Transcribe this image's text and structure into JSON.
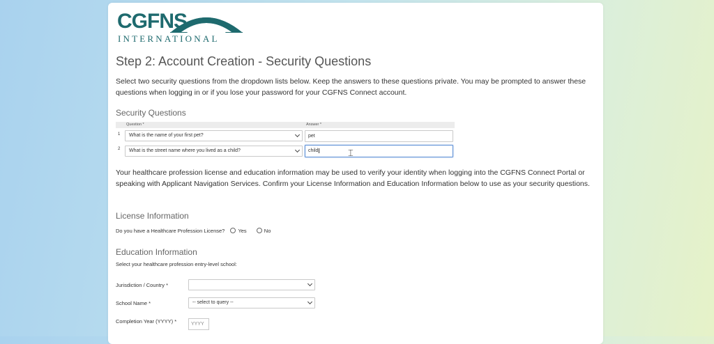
{
  "logo": {
    "main": "CGFNS",
    "sub": "INTERNATIONAL"
  },
  "page_title": "Step 2: Account Creation - Security Questions",
  "intro": "Select two security questions from the dropdown lists below. Keep the answers to these questions private. You may be prompted to answer these questions when logging in or if you lose your password for your CGFNS Connect account.",
  "security_questions": {
    "heading": "Security Questions",
    "col_question": "Question *",
    "col_answer": "Answer *",
    "rows": [
      {
        "num": "1",
        "question": "What is the name of your first pet?",
        "answer": "pet"
      },
      {
        "num": "2",
        "question": "What is the street name where you lived as a child?",
        "answer": "child"
      }
    ]
  },
  "verify_text": "Your healthcare profession license and education information may be used to verify your identity when logging into the CGFNS Connect Portal or speaking with Applicant Navigation Services. Confirm your License Information and Education Information below to use as your security questions.",
  "license": {
    "heading": "License Information",
    "question": "Do you have a Healthcare Profession License?",
    "yes": "Yes",
    "no": "No"
  },
  "education": {
    "heading": "Education Information",
    "instruction": "Select your healthcare profession entry-level school:",
    "jurisdiction_label": "Jurisdiction / Country *",
    "jurisdiction_value": "",
    "school_label": "School Name *",
    "school_value": "-- select to query --",
    "year_label": "Completion Year (YYYY) *",
    "year_placeholder": "YYYY"
  },
  "colors": {
    "brand": "#1e6a6e",
    "focus": "#5b8fd6"
  }
}
